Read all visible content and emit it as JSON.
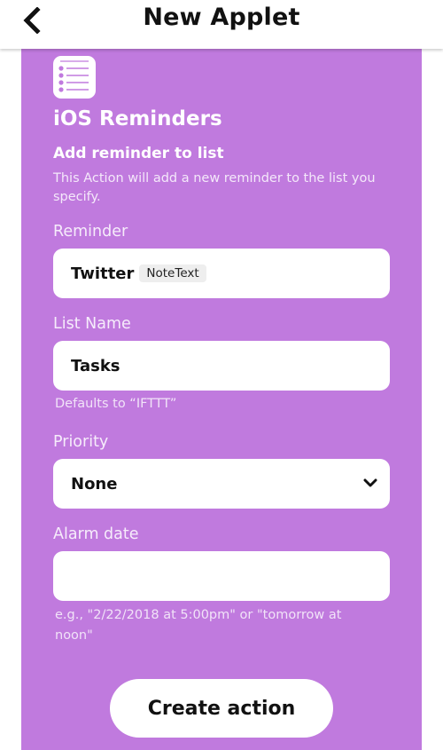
{
  "header": {
    "title": "New Applet",
    "back_icon": "chevron-left-icon"
  },
  "service": {
    "icon": "reminders-list-icon",
    "name": "iOS Reminders"
  },
  "action": {
    "title": "Add reminder to list",
    "description": "This Action will add a new reminder to the list you specify."
  },
  "fields": {
    "reminder": {
      "label": "Reminder",
      "value": "Twitter",
      "ingredient": "NoteText"
    },
    "list_name": {
      "label": "List Name",
      "value": "Tasks",
      "helper": "Defaults to “IFTTT”"
    },
    "priority": {
      "label": "Priority",
      "selected": "None",
      "dropdown_icon": "chevron-down-icon"
    },
    "alarm_date": {
      "label": "Alarm date",
      "value": "",
      "helper": "e.g., \"2/22/2018 at 5:00pm\" or \"tomorrow at noon\""
    }
  },
  "create_button": {
    "label": "Create action"
  },
  "colors": {
    "panel_background": "#c07ade",
    "field_background": "#ffffff",
    "ingredient_background": "#eeeeee",
    "header_background": "#ffffff"
  }
}
